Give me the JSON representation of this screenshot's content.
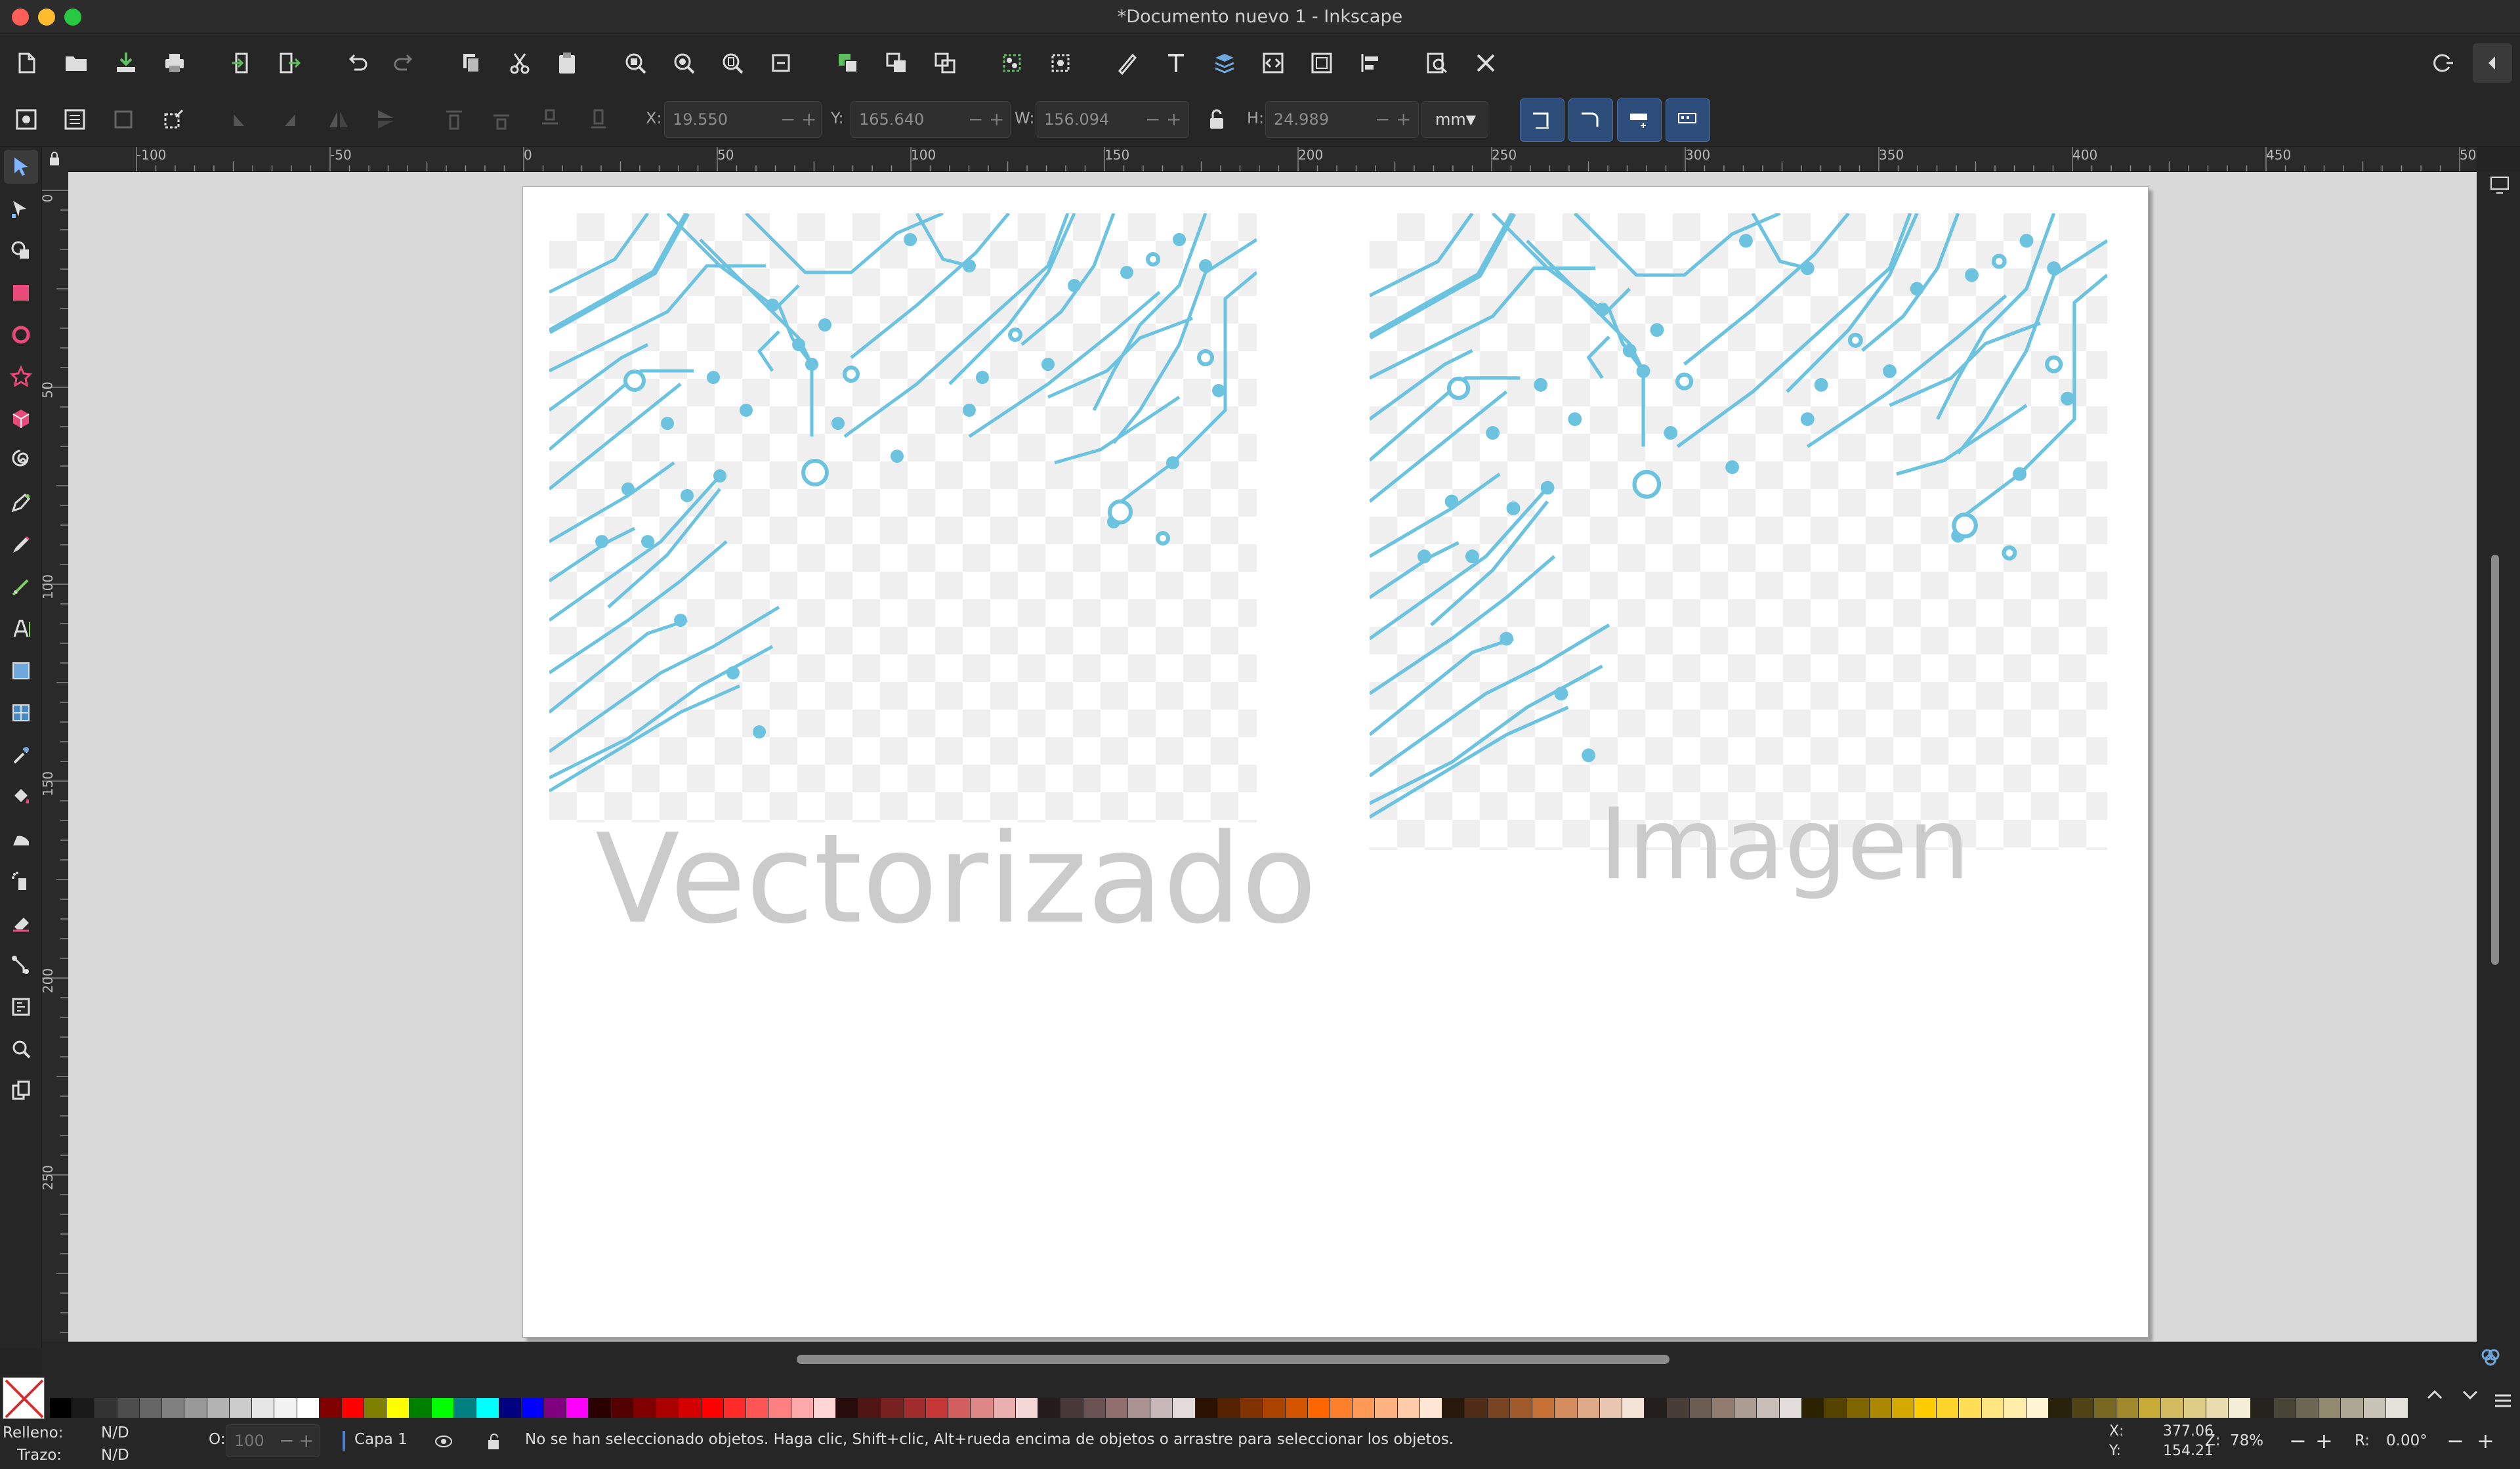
{
  "window": {
    "title": "*Documento nuevo 1 - Inkscape"
  },
  "toolbar": {
    "commands": [
      "new-doc-icon",
      "open-icon",
      "save-icon",
      "print-icon",
      "import-icon",
      "export-icon",
      "undo-icon",
      "redo-icon",
      "copy-icon",
      "cut-icon",
      "paste-icon",
      "zoom-selection-icon",
      "zoom-drawing-icon",
      "zoom-page-icon",
      "zoom-width-icon",
      "duplicate-icon",
      "clone-icon",
      "unlink-clone-icon",
      "group-icon",
      "ungroup-icon",
      "fill-stroke-icon",
      "text-font-icon",
      "layers-icon",
      "xml-editor-icon",
      "document-properties-icon",
      "align-icon",
      "find-icon",
      "preferences-icon"
    ]
  },
  "controls": {
    "x_label": "X:",
    "x_value": "19.550",
    "y_label": "Y:",
    "y_value": "165.640",
    "w_label": "W:",
    "w_value": "156.094",
    "h_label": "H:",
    "h_value": "24.989",
    "unit": "mm"
  },
  "rulers": {
    "horizontal": [
      "-100",
      "-50",
      "0",
      "50",
      "100",
      "150",
      "200",
      "250",
      "300",
      "350",
      "400",
      "450",
      "50"
    ],
    "vertical": [
      "0",
      "50",
      "100",
      "150",
      "200",
      "250"
    ]
  },
  "canvas": {
    "left_label": "Vectorizado",
    "right_label": "Imagen",
    "trace_color": "#6cc3e0"
  },
  "status": {
    "fill_label": "Relleno:",
    "fill_value": "N/D",
    "stroke_label": "Trazo:",
    "stroke_value": "N/D",
    "opacity_label": "O:",
    "opacity_value": "100",
    "layer": "Capa 1",
    "message": "No se han seleccionado objetos. Haga clic, Shift+clic, Alt+rueda encima de objetos o arrastre para seleccionar los objetos.",
    "x_label": "X:",
    "x_coord": "377.06",
    "y_label": "Y:",
    "y_coord": "154.21",
    "zoom_label": "Z:",
    "zoom_value": "78%",
    "rotation_label": "R:",
    "rotation_value": "0.00°"
  }
}
